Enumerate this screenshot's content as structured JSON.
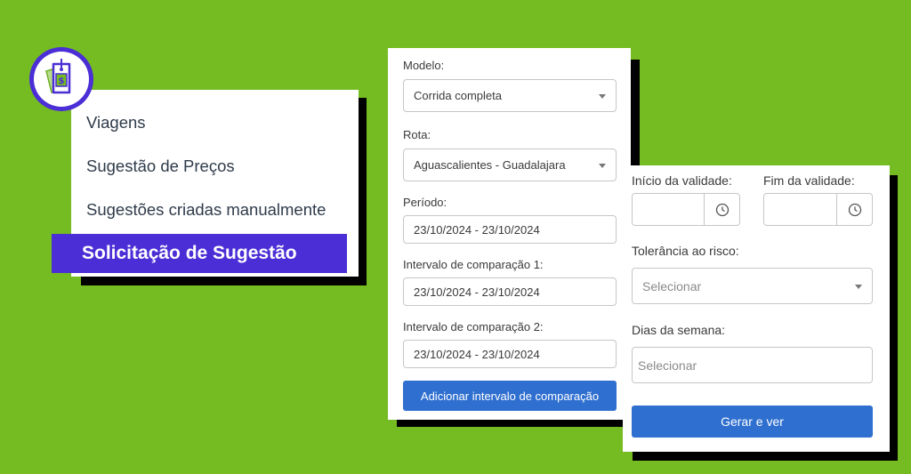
{
  "menu": {
    "items": [
      {
        "label": "Viagens"
      },
      {
        "label": "Sugestão de Preços"
      },
      {
        "label": "Sugestões criadas manualmente"
      }
    ],
    "active_label": "Solicitação de Sugestão"
  },
  "logo": {
    "icon": "price-tag-icon",
    "symbol": "$"
  },
  "form_main": {
    "modelo_label": "Modelo:",
    "modelo_value": "Corrida completa",
    "rota_label": "Rota:",
    "rota_value": "Aguascalientes - Guadalajara",
    "periodo_label": "Período:",
    "periodo_value": "23/10/2024 - 23/10/2024",
    "comp1_label": "Intervalo de comparação 1:",
    "comp1_value": "23/10/2024 - 23/10/2024",
    "comp2_label": "Intervalo de comparação 2:",
    "comp2_value": "23/10/2024 - 23/10/2024",
    "add_button": "Adicionar intervalo de comparação"
  },
  "form_side": {
    "inicio_label": "Início da validade:",
    "fim_label": "Fim da validade:",
    "tolerancia_label": "Tolerância ao risco:",
    "tolerancia_placeholder": "Selecionar",
    "dias_label": "Dias da semana:",
    "dias_placeholder": "Selecionar",
    "generate_button": "Gerar e ver"
  },
  "colors": {
    "background": "#74bc21",
    "accent": "#4b2ed6",
    "button": "#2f6fd0"
  }
}
